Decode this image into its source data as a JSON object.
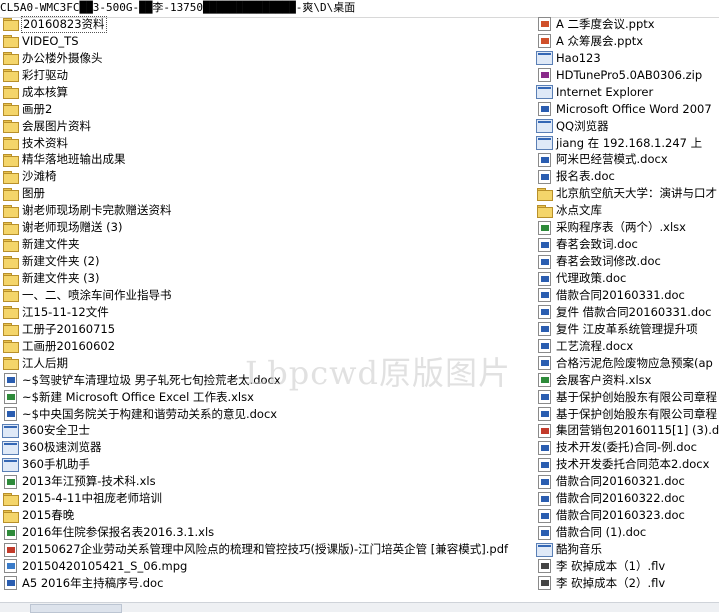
{
  "path": "CL5A0-WMC3FC██3-500G-██李-13750██████████████-爽\\D\\桌面",
  "watermark": "Lbpcwd原版图片",
  "left_items": [
    {
      "icon": "folder",
      "label": "20160823资料",
      "selected": true
    },
    {
      "icon": "folder",
      "label": "VIDEO_TS"
    },
    {
      "icon": "folder",
      "label": "办公楼外摄像头"
    },
    {
      "icon": "folder",
      "label": "彩打驱动"
    },
    {
      "icon": "folder",
      "label": "成本核算"
    },
    {
      "icon": "folder",
      "label": "画册2"
    },
    {
      "icon": "folder",
      "label": "会展图片资料"
    },
    {
      "icon": "folder",
      "label": "技术资料"
    },
    {
      "icon": "folder",
      "label": "精华落地班输出成果"
    },
    {
      "icon": "folder",
      "label": "沙滩椅"
    },
    {
      "icon": "folder",
      "label": "图册"
    },
    {
      "icon": "folder",
      "label": "谢老师现场刷卡完款赠送资料"
    },
    {
      "icon": "folder",
      "label": "谢老师现场赠送 (3)"
    },
    {
      "icon": "folder",
      "label": "新建文件夹"
    },
    {
      "icon": "folder",
      "label": "新建文件夹 (2)"
    },
    {
      "icon": "folder",
      "label": "新建文件夹 (3)"
    },
    {
      "icon": "folder",
      "label": "一、二、喷涂车间作业指导书"
    },
    {
      "icon": "folder",
      "label": "江15-11-12文件",
      "blur": true
    },
    {
      "icon": "folder",
      "label": "工册子20160715",
      "blur": true
    },
    {
      "icon": "folder",
      "label": "工画册20160602",
      "blur": true
    },
    {
      "icon": "folder",
      "label": "江人后期",
      "blur": true
    },
    {
      "icon": "doc",
      "color": "#2a5db0",
      "label": "~$驾驶铲车清理垃圾 男子轧死七旬捡荒老太.docx"
    },
    {
      "icon": "doc",
      "color": "#2e8b3a",
      "label": "~$新建 Microsoft Office Excel 工作表.xlsx"
    },
    {
      "icon": "doc",
      "color": "#2a5db0",
      "label": "~$中央国务院关于构建和谐劳动关系的意见.docx"
    },
    {
      "icon": "exe",
      "label": "360安全卫士"
    },
    {
      "icon": "exe",
      "label": "360极速浏览器"
    },
    {
      "icon": "exe",
      "label": "360手机助手"
    },
    {
      "icon": "doc",
      "color": "#2e8b3a",
      "label": "2013年江预算-技术科.xls",
      "blur_mid": true
    },
    {
      "icon": "folder",
      "label": "2015-4-11中祖庞老师培训"
    },
    {
      "icon": "folder",
      "label": "2015春晚"
    },
    {
      "icon": "doc",
      "color": "#2e8b3a",
      "label": "2016年住院参保报名表2016.3.1.xls"
    },
    {
      "icon": "doc",
      "color": "#c23a2a",
      "label": "20150627企业劳动关系管理中风险点的梳理和管控技巧(授课版)-江门培英企管 [兼容模式].pdf"
    },
    {
      "icon": "doc",
      "color": "#3a7bc8",
      "label": "20150420105421_S_06.mpg"
    },
    {
      "icon": "doc",
      "color": "#2a5db0",
      "label": "A5 2016年主持稿序号.doc"
    }
  ],
  "right_items": [
    {
      "icon": "doc",
      "color": "#d0502a",
      "label": "A 二季度会议.pptx",
      "blur": true
    },
    {
      "icon": "doc",
      "color": "#d0502a",
      "label": "A 众筹展会.pptx",
      "blur": true
    },
    {
      "icon": "exe",
      "label": "Hao123"
    },
    {
      "icon": "doc",
      "color": "#8a2a8a",
      "label": "HDTunePro5.0AB0306.zip"
    },
    {
      "icon": "exe",
      "label": "Internet Explorer"
    },
    {
      "icon": "doc",
      "color": "#2a5db0",
      "label": "Microsoft Office Word 2007"
    },
    {
      "icon": "exe",
      "label": "QQ浏览器"
    },
    {
      "icon": "exe",
      "label": "jiang 在 192.168.1.247 上",
      "blur": true
    },
    {
      "icon": "doc",
      "color": "#2a5db0",
      "label": "阿米巴经营模式.docx"
    },
    {
      "icon": "doc",
      "color": "#2a5db0",
      "label": "报名表.doc"
    },
    {
      "icon": "folder",
      "label": "北京航空航天大学：演讲与口才"
    },
    {
      "icon": "folder",
      "label": "冰点文库"
    },
    {
      "icon": "doc",
      "color": "#2e8b3a",
      "label": "采购程序表（两个）.xlsx"
    },
    {
      "icon": "doc",
      "color": "#2a5db0",
      "label": "春茗会致词.doc"
    },
    {
      "icon": "doc",
      "color": "#2a5db0",
      "label": "春茗会致词修改.doc"
    },
    {
      "icon": "doc",
      "color": "#2a5db0",
      "label": "代理政策.doc"
    },
    {
      "icon": "doc",
      "color": "#2a5db0",
      "label": "借款合同20160331.doc",
      "blur": true
    },
    {
      "icon": "doc",
      "color": "#2a5db0",
      "label": "复件 借款合同20160331.doc"
    },
    {
      "icon": "doc",
      "color": "#2a5db0",
      "label": "复件 江皮革系统管理提升项",
      "blur_mid": true
    },
    {
      "icon": "doc",
      "color": "#2a5db0",
      "label": "工艺流程.docx"
    },
    {
      "icon": "doc",
      "color": "#2a5db0",
      "label": "合格污泥危险废物应急预案(ap"
    },
    {
      "icon": "doc",
      "color": "#2e8b3a",
      "label": "会展客户资料.xlsx"
    },
    {
      "icon": "doc",
      "color": "#2a5db0",
      "label": "基于保护创始股东有限公司章程"
    },
    {
      "icon": "doc",
      "color": "#2a5db0",
      "label": "基于保护创始股东有限公司章程"
    },
    {
      "icon": "doc",
      "color": "#c23a2a",
      "label": "集团营销包20160115[1] (3).d"
    },
    {
      "icon": "doc",
      "color": "#2a5db0",
      "label": "技术开发(委托)合同-例.doc"
    },
    {
      "icon": "doc",
      "color": "#2a5db0",
      "label": "技术开发委托合同范本2.docx"
    },
    {
      "icon": "doc",
      "color": "#2a5db0",
      "label": "借款合同20160321.doc"
    },
    {
      "icon": "doc",
      "color": "#2a5db0",
      "label": "借款合同20160322.doc"
    },
    {
      "icon": "doc",
      "color": "#2a5db0",
      "label": "借款合同20160323.doc"
    },
    {
      "icon": "doc",
      "color": "#2a5db0",
      "label": "借款合同 (1).doc"
    },
    {
      "icon": "exe",
      "label": "酷狗音乐"
    },
    {
      "icon": "doc",
      "color": "#444444",
      "label": "李 砍掉成本（1）.flv",
      "blur_mid": true
    },
    {
      "icon": "doc",
      "color": "#444444",
      "label": "李 砍掉成本（2）.flv",
      "blur_mid": true
    }
  ]
}
